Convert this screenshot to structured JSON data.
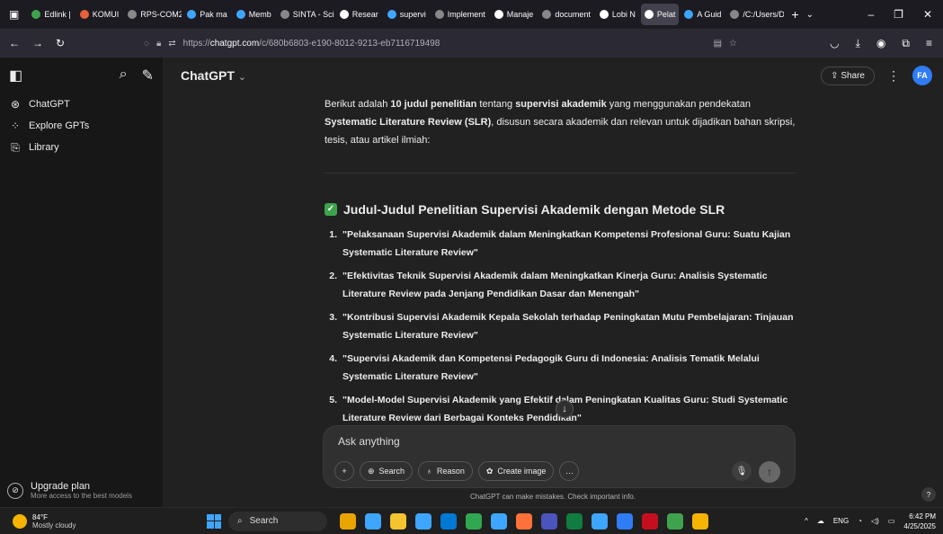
{
  "browser": {
    "tabs": [
      {
        "label": "Edlink |",
        "color": "#3fa34d"
      },
      {
        "label": "KOMUI",
        "color": "#e6623a"
      },
      {
        "label": "RPS-COM2",
        "color": "#888888"
      },
      {
        "label": "Pak ma",
        "color": "#3ea6ff"
      },
      {
        "label": "Memb",
        "color": "#3ea6ff"
      },
      {
        "label": "SINTA - Sci",
        "color": "#888888"
      },
      {
        "label": "Resear",
        "color": "#ffffff"
      },
      {
        "label": "supervi",
        "color": "#3ea6ff"
      },
      {
        "label": "Implement",
        "color": "#888888"
      },
      {
        "label": "Manaje",
        "color": "#ffffff"
      },
      {
        "label": "document",
        "color": "#888888"
      },
      {
        "label": "Lobi N",
        "color": "#ffffff"
      },
      {
        "label": "Pelat",
        "color": "#ffffff"
      },
      {
        "label": "A Guid",
        "color": "#3ea6ff"
      },
      {
        "label": "/C:/Users/D",
        "color": "#888888"
      }
    ],
    "url_prefix": "https://",
    "url_domain": "chatgpt.com",
    "url_path": "/c/680b6803-e190-8012-9213-eb7116719498"
  },
  "sidebar": {
    "items": [
      {
        "label": "ChatGPT",
        "icon": "⊛"
      },
      {
        "label": "Explore GPTs",
        "icon": "⁘"
      },
      {
        "label": "Library",
        "icon": "⎘"
      }
    ],
    "upgrade_title": "Upgrade plan",
    "upgrade_sub": "More access to the best models"
  },
  "header": {
    "model": "ChatGPT",
    "share": "Share",
    "avatar": "FA"
  },
  "message": {
    "intro_1": "Berikut adalah ",
    "intro_b1": "10 judul penelitian",
    "intro_2": " tentang ",
    "intro_b2": "supervisi akademik",
    "intro_3": " yang menggunakan pendekatan ",
    "intro_b3": "Systematic Literature Review (SLR)",
    "intro_4": ", disusun secara akademik dan relevan untuk dijadikan bahan skripsi, tesis, atau artikel ilmiah:",
    "heading": "Judul-Judul Penelitian Supervisi Akademik dengan Metode SLR",
    "items": [
      {
        "n": "1.",
        "text": "\"Pelaksanaan Supervisi Akademik dalam Meningkatkan Kompetensi Profesional Guru: Suatu Kajian Systematic Literature Review\""
      },
      {
        "n": "2.",
        "text": "\"Efektivitas Teknik Supervisi Akademik dalam Meningkatkan Kinerja Guru: Analisis Systematic Literature Review pada Jenjang Pendidikan Dasar dan Menengah\""
      },
      {
        "n": "3.",
        "text": "\"Kontribusi Supervisi Akademik Kepala Sekolah terhadap Peningkatan Mutu Pembelajaran: Tinjauan Systematic Literature Review\""
      },
      {
        "n": "4.",
        "text": "\"Supervisi Akademik dan Kompetensi Pedagogik Guru di Indonesia: Analisis Tematik Melalui Systematic Literature Review\""
      },
      {
        "n": "5.",
        "text": "\"Model-Model Supervisi Akademik yang Efektif dalam Peningkatan Kualitas Guru: Studi Systematic Literature Review dari Berbagai Konteks Pendidikan\""
      }
    ]
  },
  "composer": {
    "placeholder": "Ask anything",
    "search": "Search",
    "reason": "Reason",
    "create_image": "Create image"
  },
  "disclaimer": "ChatGPT can make mistakes. Check important info.",
  "taskbar": {
    "temp": "84°F",
    "weather": "Mostly cloudy",
    "search": "Search",
    "lang": "ENG",
    "time": "6:42 PM",
    "date": "4/25/2025",
    "app_colors": [
      "#e9a400",
      "#3ea6ff",
      "#f4c430",
      "#3ea6ff",
      "#0078d4",
      "#2fa84f",
      "#3ea6ff",
      "#ff7139",
      "#4b53bc",
      "#107c41",
      "#3ea6ff",
      "#2f7cf6",
      "#c50f1f",
      "#3fa34d",
      "#f4b400"
    ]
  }
}
